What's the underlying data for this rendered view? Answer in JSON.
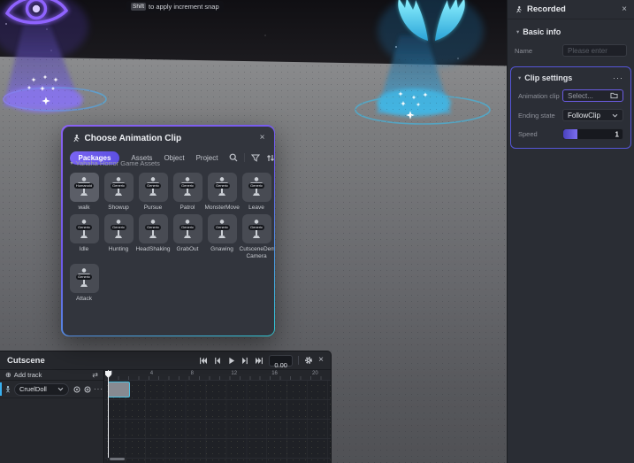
{
  "colors": {
    "accent_purple": "#6c5ce7",
    "accent_cyan": "#45c8e8",
    "panel_bg": "#2a2d34",
    "modal_bg": "#32353d",
    "timeline_bg": "#26282d"
  },
  "icons": {
    "close": "×",
    "menu_dots": "···",
    "caret_down": "▾",
    "plus_circle": "⊕",
    "swap_arrows": "⇄"
  },
  "tooltip": {
    "key": "Shift",
    "text": "to apply increment snap"
  },
  "inspector": {
    "title": "Recorded",
    "basic_info": {
      "title": "Basic info",
      "name_label": "Name",
      "name_placeholder": "Please enter"
    },
    "clip_settings": {
      "title": "Clip settings",
      "animation_clip_label": "Animation clip",
      "animation_clip_value": "Select...",
      "ending_state_label": "Ending state",
      "ending_state_value": "FollowClip",
      "speed_label": "Speed",
      "speed_value": "1",
      "speed_fill_percent": 24
    }
  },
  "modal": {
    "title": "Choose Animation Clip",
    "tabs": [
      {
        "label": "Packages",
        "active": true
      },
      {
        "label": "Assets",
        "active": false
      },
      {
        "label": "Object",
        "active": false
      },
      {
        "label": "Project",
        "active": false
      }
    ],
    "section_title": "Yahaha Horror Game Assets",
    "clips": [
      {
        "name": "walk",
        "rig": "Humanoid",
        "selected": true
      },
      {
        "name": "Showup",
        "rig": "Generic",
        "selected": false
      },
      {
        "name": "Pursue",
        "rig": "Generic",
        "selected": false
      },
      {
        "name": "Patrol",
        "rig": "Generic",
        "selected": false
      },
      {
        "name": "MonsterMove",
        "rig": "Generic",
        "selected": false
      },
      {
        "name": "Leave",
        "rig": "Generic",
        "selected": false
      },
      {
        "name": "Idle",
        "rig": "Generic",
        "selected": false
      },
      {
        "name": "Hunting",
        "rig": "Generic",
        "selected": false
      },
      {
        "name": "HeadShaking",
        "rig": "Generic",
        "selected": false
      },
      {
        "name": "GrabOut",
        "rig": "Generic",
        "selected": false
      },
      {
        "name": "Gnawing",
        "rig": "Generic",
        "selected": false
      },
      {
        "name": "CutsceneDemo Camera",
        "rig": "Generic",
        "selected": false
      },
      {
        "name": "Attack",
        "rig": "Generic",
        "selected": false
      }
    ]
  },
  "timeline": {
    "title": "Cutscene",
    "add_track_label": "Add track",
    "time_value": "0.00",
    "ruler_ticks": [
      "0",
      "4",
      "8",
      "12",
      "16",
      "20"
    ],
    "tracks": [
      {
        "name": "CruelDoll"
      }
    ]
  }
}
